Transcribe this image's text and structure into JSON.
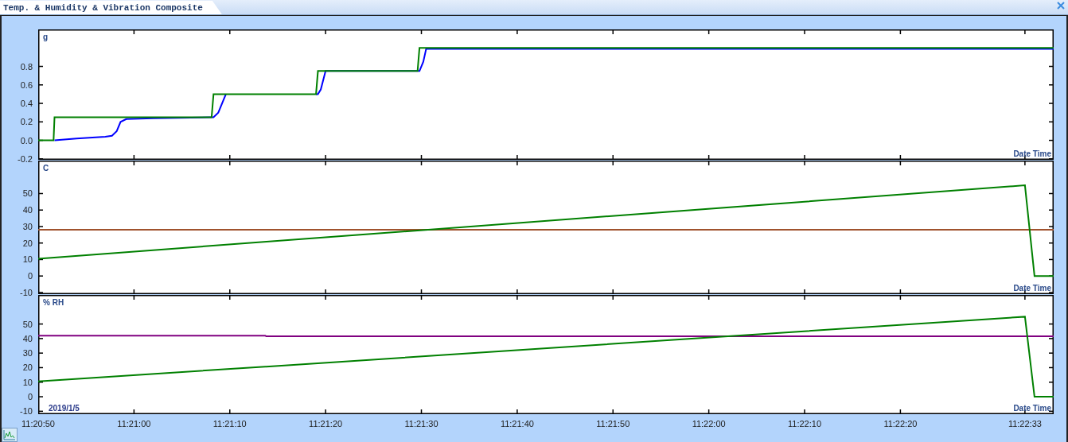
{
  "tab": {
    "label": "Temp. & Humidity & Vibration Composite",
    "selected": true
  },
  "charts": [
    {
      "chart_data": {
        "type": "line",
        "ylabel": "g",
        "xlabel": "Date Time",
        "x": [
          40850,
          40851.6,
          40851.7,
          40854,
          40857,
          40857.7,
          40858.2,
          40858.6,
          40859.2,
          40862,
          40868.1,
          40868.3,
          40868.8,
          40869.4,
          40869.6,
          40873.7,
          40873.8,
          40879,
          40879.2,
          40879.5,
          40880,
          40889.6,
          40889.8,
          40890.2,
          40890.5,
          40953,
          40954,
          40956
        ],
        "xlim": [
          40850,
          40956
        ],
        "ylim": [
          -0.21,
          1.2
        ],
        "yticks": [
          {
            "value": -0.2,
            "label": "-0.2"
          },
          {
            "value": 0,
            "label": "0.0"
          },
          {
            "value": 0.2,
            "label": "0.2"
          },
          {
            "value": 0.4,
            "label": "0.4"
          },
          {
            "value": 0.6,
            "label": "0.6"
          },
          {
            "value": 0.8,
            "label": "0.8"
          }
        ],
        "series": [
          {
            "color": "#0000ff",
            "values": [
              null,
              null,
              0,
              0.02,
              0.04,
              0.05,
              0.1,
              0.2,
              0.23,
              0.24,
              0.25,
              0.25,
              0.3,
              0.45,
              0.5,
              null,
              null,
              0.5,
              0.5,
              0.55,
              0.75,
              0.75,
              0.75,
              0.85,
              0.99,
              0.99,
              0.99,
              0.99
            ]
          },
          {
            "color": "#008000",
            "values": [
              0,
              0,
              0.25,
              0.25,
              0.25,
              0.25,
              0.25,
              0.25,
              0.25,
              0.25,
              0.25,
              0.5,
              0.5,
              0.5,
              0.5,
              0.5,
              0.5,
              0.5,
              0.75,
              0.75,
              0.75,
              0.75,
              1,
              1,
              1,
              1,
              1,
              1
            ]
          }
        ]
      }
    },
    {
      "chart_data": {
        "type": "line",
        "ylabel": "C",
        "xlabel": "Date Time",
        "x": [
          40850,
          40953,
          40954,
          40956
        ],
        "xlim": [
          40850,
          40956
        ],
        "ylim": [
          -11,
          70
        ],
        "yticks": [
          {
            "value": -10,
            "label": "-10"
          },
          {
            "value": 0,
            "label": "0"
          },
          {
            "value": 10,
            "label": "10"
          },
          {
            "value": 20,
            "label": "20"
          },
          {
            "value": 30,
            "label": "30"
          },
          {
            "value": 40,
            "label": "40"
          },
          {
            "value": 50,
            "label": "50"
          }
        ],
        "series": [
          {
            "color": "#a0522d",
            "values": [
              28,
              28,
              28,
              28
            ]
          },
          {
            "color": "#008000",
            "values": [
              10.5,
              55,
              0,
              0
            ]
          }
        ]
      }
    },
    {
      "date_label": "2019/1/5",
      "chart_data": {
        "type": "line",
        "ylabel": "% RH",
        "xlabel": "Date Time",
        "x": [
          40850,
          40873.7,
          40873.8,
          40953,
          40954,
          40956
        ],
        "xlim": [
          40850,
          40956
        ],
        "ylim": [
          -12,
          70
        ],
        "xticks": [
          {
            "value": 40850,
            "label": "11:20:50"
          },
          {
            "value": 40860,
            "label": "11:21:00"
          },
          {
            "value": 40870,
            "label": "11:21:10"
          },
          {
            "value": 40880,
            "label": "11:21:20"
          },
          {
            "value": 40890,
            "label": "11:21:30"
          },
          {
            "value": 40900,
            "label": "11:21:40"
          },
          {
            "value": 40910,
            "label": "11:21:50"
          },
          {
            "value": 40920,
            "label": "11:22:00"
          },
          {
            "value": 40930,
            "label": "11:22:10"
          },
          {
            "value": 40940,
            "label": "11:22:20"
          },
          {
            "value": 40953,
            "label": "11:22:33"
          }
        ],
        "yticks": [
          {
            "value": -10,
            "label": "-10"
          },
          {
            "value": 0,
            "label": "0"
          },
          {
            "value": 10,
            "label": "10"
          },
          {
            "value": 20,
            "label": "20"
          },
          {
            "value": 30,
            "label": "30"
          },
          {
            "value": 40,
            "label": "40"
          },
          {
            "value": 50,
            "label": "50"
          }
        ],
        "series": [
          {
            "color": "#800080",
            "values": [
              42,
              42,
              41.5,
              41.5,
              41.5,
              41.5
            ]
          },
          {
            "color": "#008000",
            "values": [
              10.5,
              20.7,
              20.7,
              55,
              0,
              0
            ]
          }
        ]
      }
    }
  ]
}
